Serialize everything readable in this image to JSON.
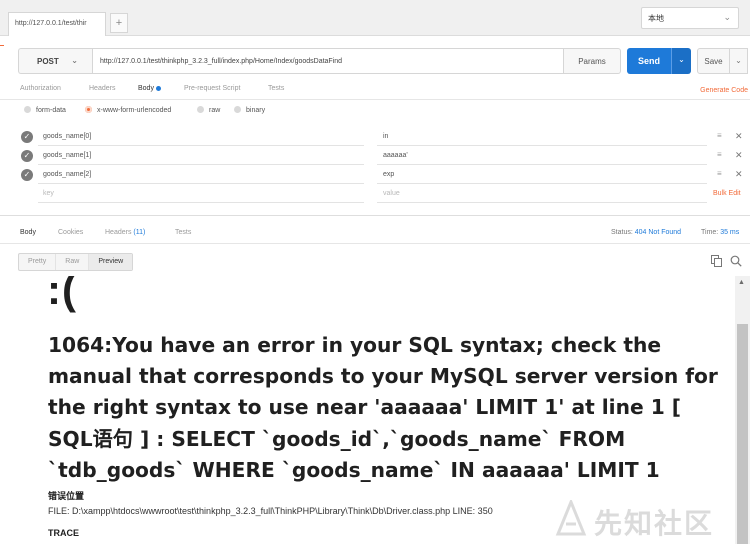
{
  "tabs": {
    "active_url": "http://127.0.0.1/test/thir",
    "add_label": "+"
  },
  "environment": {
    "selected": "本地"
  },
  "request": {
    "method": "POST",
    "url": "http://127.0.0.1/test/thinkphp_3.2.3_full/index.php/Home/Index/goodsDataFind",
    "params_label": "Params",
    "send_label": "Send",
    "save_label": "Save"
  },
  "request_tabs": [
    {
      "label": "Authorization"
    },
    {
      "label": "Headers"
    },
    {
      "label": "Body"
    },
    {
      "label": "Pre-request Script"
    },
    {
      "label": "Tests"
    }
  ],
  "generate_code_label": "Generate Code",
  "body_types": [
    {
      "label": "form-data",
      "selected": false
    },
    {
      "label": "x-www-form-urlencoded",
      "selected": true
    },
    {
      "label": "raw",
      "selected": false
    },
    {
      "label": "binary",
      "selected": false
    }
  ],
  "params": [
    {
      "key": "goods_name[0]",
      "value": "in"
    },
    {
      "key": "goods_name[1]",
      "value": "aaaaaa'"
    },
    {
      "key": "goods_name[2]",
      "value": "exp"
    }
  ],
  "param_placeholders": {
    "key": "key",
    "value": "value"
  },
  "bulk_edit_label": "Bulk Edit",
  "response_tabs": [
    {
      "label": "Body"
    },
    {
      "label": "Cookies"
    },
    {
      "label": "Headers",
      "count": "(11)"
    },
    {
      "label": "Tests"
    }
  ],
  "response_status": {
    "status_label": "Status:",
    "status_value": "404 Not Found",
    "time_label": "Time:",
    "time_value": "35 ms"
  },
  "view_modes": [
    {
      "label": "Pretty"
    },
    {
      "label": "Raw"
    },
    {
      "label": "Preview"
    }
  ],
  "error_page": {
    "face": ":(",
    "message": "1064:You have an error in your SQL syntax; check the manual that corresponds to your MySQL server version for the right syntax to use near 'aaaaaa' LIMIT 1' at line 1 [ SQL语句 ] : SELECT `goods_id`,`goods_name` FROM `tdb_goods` WHERE `goods_name` IN aaaaaa' LIMIT 1",
    "location_title": "错误位置",
    "file_line": "FILE: D:\\xampp\\htdocs\\wwwroot\\test\\thinkphp_3.2.3_full\\ThinkPHP\\Library\\Think\\Db\\Driver.class.php    LINE: 350",
    "trace_title": "TRACE"
  },
  "watermark": "先知社区",
  "colors": {
    "accent": "#f26b3a",
    "send": "#1e7ad9",
    "text": "#202020"
  }
}
